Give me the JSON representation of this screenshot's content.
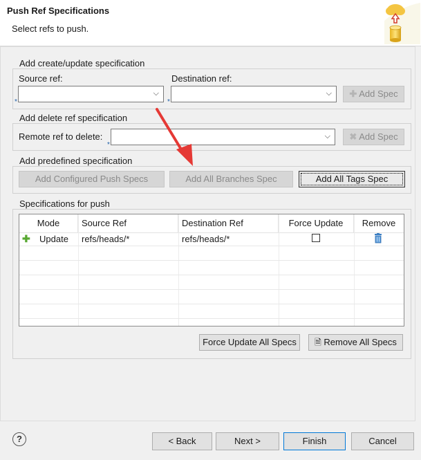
{
  "dialog": {
    "title": "Push Ref Specifications",
    "subtitle": "Select refs to push."
  },
  "create_update": {
    "group_title": "Add create/update specification",
    "source_label": "Source ref:",
    "destination_label": "Destination ref:",
    "source_value": "",
    "destination_value": "",
    "required_marker": "*",
    "add_spec_label": "Add Spec"
  },
  "delete_ref": {
    "group_title": "Add delete ref specification",
    "remote_label": "Remote ref to delete:",
    "remote_value": "",
    "required_marker": "*",
    "add_spec_label": "Add Spec"
  },
  "predefined": {
    "group_title": "Add predefined specification",
    "configured_label": "Add Configured Push Specs",
    "all_branches_label": "Add All Branches Spec",
    "all_tags_label": "Add All Tags Spec"
  },
  "specs": {
    "group_title": "Specifications for push",
    "columns": [
      "Mode",
      "Source Ref",
      "Destination Ref",
      "Force Update",
      "Remove"
    ],
    "rows": [
      {
        "mode": "Update",
        "source": "refs/heads/*",
        "destination": "refs/heads/*",
        "force_update": false
      }
    ],
    "force_update_all_label": "Force Update All Specs",
    "remove_all_label": "Remove All Specs"
  },
  "footer": {
    "help_icon": "?",
    "back_label": "< Back",
    "next_label": "Next >",
    "finish_label": "Finish",
    "cancel_label": "Cancel"
  },
  "annotation": {
    "arrow_color": "#e53935"
  },
  "colors": {
    "accent": "#0078d7",
    "plus_green": "#58a832"
  }
}
